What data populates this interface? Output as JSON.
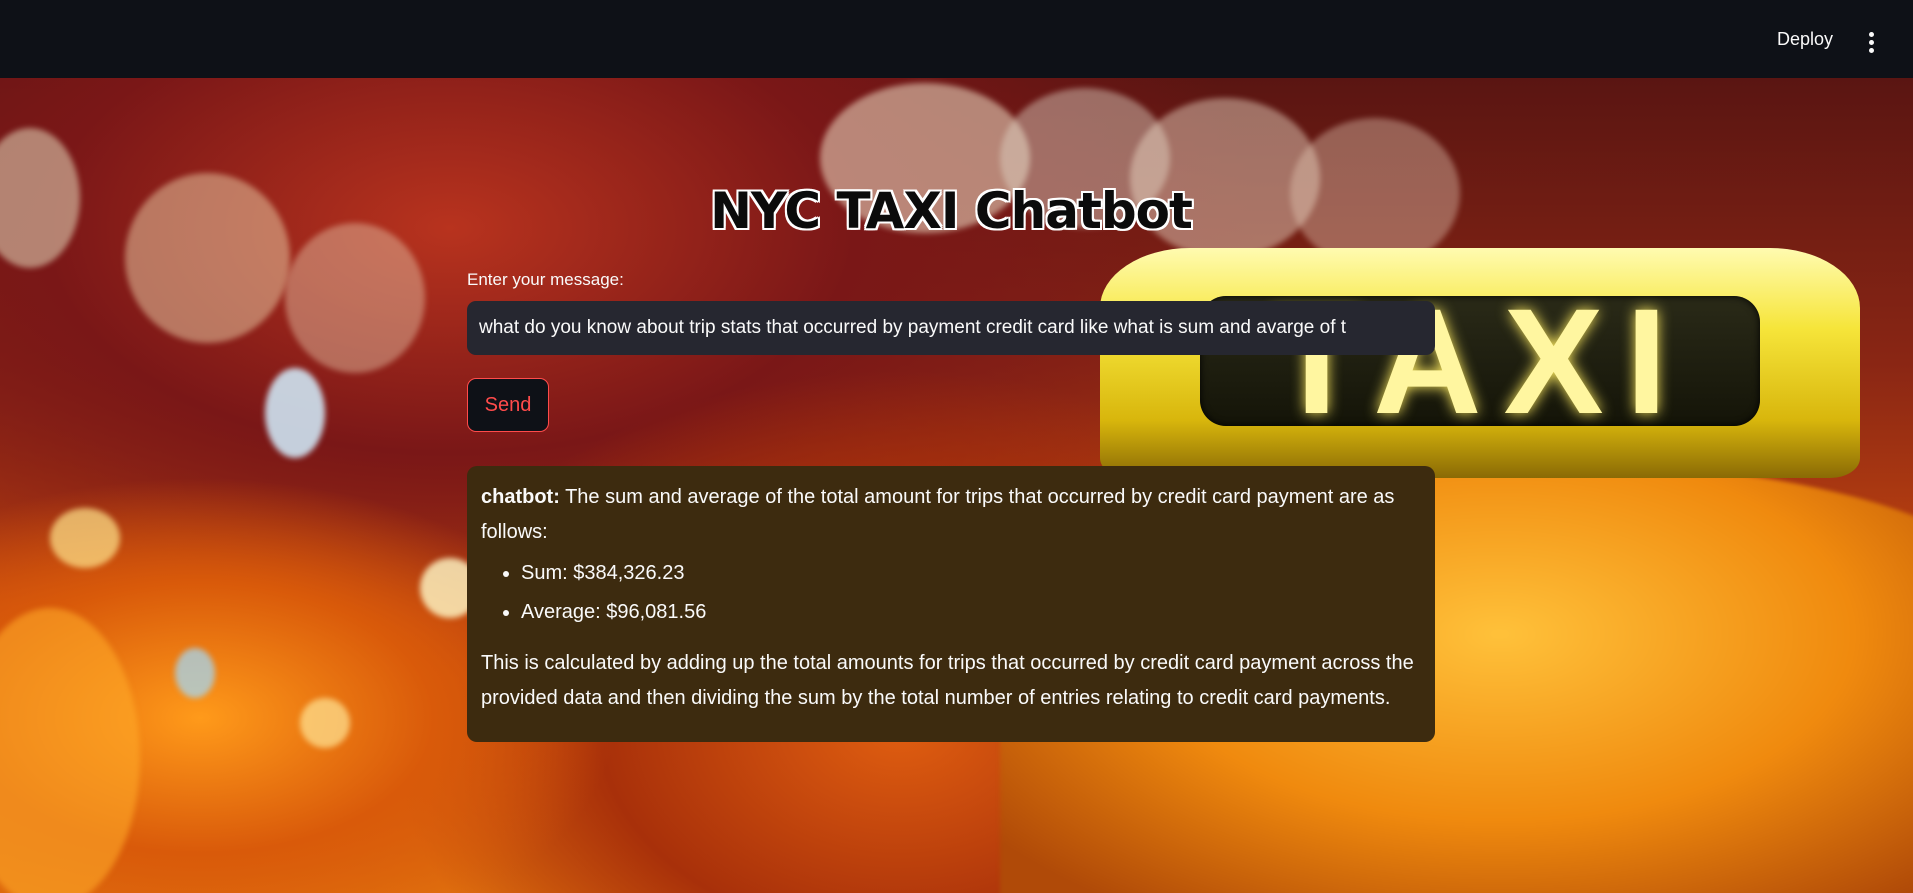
{
  "header": {
    "deploy_label": "Deploy",
    "menu_icon": "kebab-menu-icon"
  },
  "background": {
    "sign_text": "TAXI"
  },
  "main": {
    "title": "NYC TAXI Chatbot",
    "input_label": "Enter your message:",
    "input_value": "what do you know about trip stats that occurred by payment credit card like what is sum and avarge of t",
    "send_label": "Send"
  },
  "response": {
    "speaker": "chatbot:",
    "intro": "The sum and average of the total amount for trips that occurred by credit card payment are as follows:",
    "items": [
      "Sum: $384,326.23",
      "Average: $96,081.56"
    ],
    "explanation": "This is calculated by adding up the total amounts for trips that occurred by credit card payment across the provided data and then dividing the sum by the total number of entries relating to credit card payments."
  },
  "colors": {
    "header_bg": "#0e1117",
    "input_bg": "#262730",
    "accent": "#ff4b4b",
    "chat_bg": "#3d2b0f"
  }
}
